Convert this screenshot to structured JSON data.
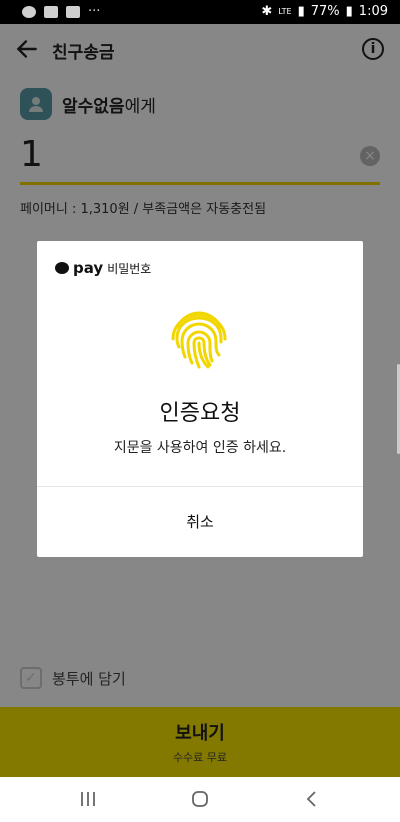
{
  "status_bar": {
    "network": "LTE",
    "battery": "77%",
    "time": "1:09"
  },
  "header": {
    "title": "친구송금"
  },
  "recipient": {
    "name": "알수없음",
    "suffix": "에게"
  },
  "amount": {
    "value": "1"
  },
  "balance": {
    "text": "페이머니 : 1,310원 / 부족금액은 자동충전됨"
  },
  "envelope": {
    "label": "봉투에 담기"
  },
  "send": {
    "label": "보내기",
    "sub": "수수료 무료"
  },
  "dialog": {
    "brand": "pay",
    "header": "비밀번호",
    "title": "인증요청",
    "message": "지문을 사용하여 인증 하세요.",
    "cancel": "취소"
  },
  "colors": {
    "accent": "#f7e500",
    "fingerprint": "#f2d600"
  }
}
